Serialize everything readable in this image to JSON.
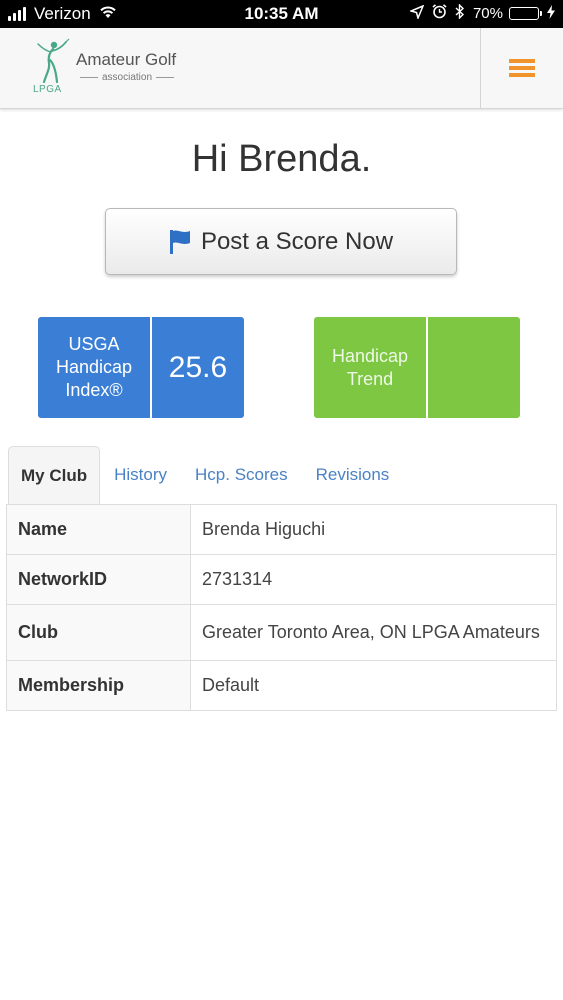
{
  "status_bar": {
    "carrier": "Verizon",
    "time": "10:35 AM",
    "battery_percent": "70%",
    "battery_level": 0.7,
    "icons": [
      "signal-icon",
      "wifi-icon",
      "location-icon",
      "alarm-icon",
      "bluetooth-icon",
      "battery-icon",
      "charging-icon"
    ]
  },
  "header": {
    "logo_lpga": "LPGA",
    "logo_title": "Amateur Golf",
    "logo_subtitle": "association",
    "menu_icon": "hamburger-icon",
    "accent_color": "#f0932b"
  },
  "greeting": "Hi Brenda.",
  "post_score": {
    "label": "Post a Score Now",
    "icon": "flag-icon",
    "icon_color": "#2f6fc4"
  },
  "cards": {
    "handicap_index": {
      "label": "USGA\nHandicap\nIndex®",
      "value": "25.6",
      "color": "#3a7fd5"
    },
    "handicap_trend": {
      "label": "Handicap\nTrend",
      "value": "",
      "color": "#7dc743"
    }
  },
  "tabs": [
    {
      "label": "My Club",
      "active": true
    },
    {
      "label": "History",
      "active": false
    },
    {
      "label": "Hcp. Scores",
      "active": false
    },
    {
      "label": "Revisions",
      "active": false
    }
  ],
  "club_table": [
    {
      "key": "Name",
      "value": "Brenda Higuchi"
    },
    {
      "key": "NetworkID",
      "value": "2731314"
    },
    {
      "key": "Club",
      "value": "Greater Toronto Area, ON LPGA Amateurs"
    },
    {
      "key": "Membership",
      "value": "Default"
    }
  ]
}
